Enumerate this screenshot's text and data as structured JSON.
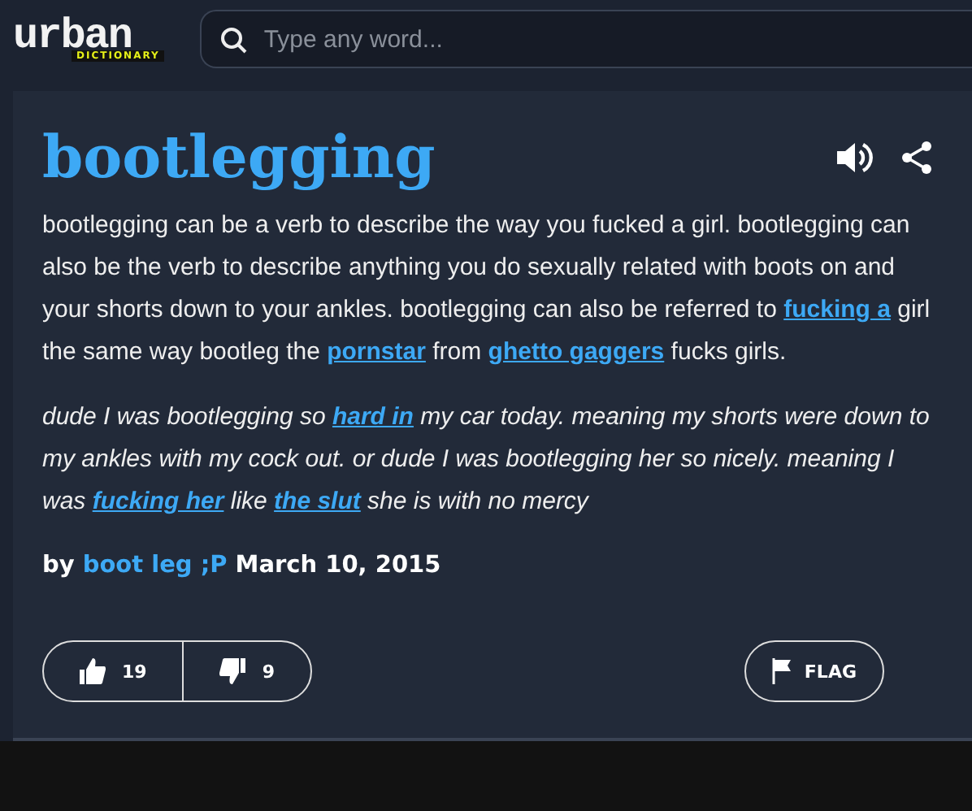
{
  "header": {
    "logo": {
      "word": "urban",
      "sub": "DICTIONARY"
    },
    "search": {
      "placeholder": "Type any word..."
    }
  },
  "entry": {
    "word": "bootlegging",
    "meaning": [
      {
        "text": "bootlegging can be a verb to describe the way you fucked a girl. bootlegging can also be the verb to describe anything you do sexually related with boots on and your shorts down to your ankles. bootlegging can also be referred to ",
        "kind": "text"
      },
      {
        "text": "fucking a",
        "kind": "link"
      },
      {
        "text": " girl the same way bootleg the ",
        "kind": "text"
      },
      {
        "text": "pornstar",
        "kind": "link"
      },
      {
        "text": " from ",
        "kind": "text"
      },
      {
        "text": "ghetto gaggers",
        "kind": "link"
      },
      {
        "text": " fucks girls.",
        "kind": "text"
      }
    ],
    "example": [
      {
        "text": "dude I was bootlegging so ",
        "kind": "text"
      },
      {
        "text": "hard in",
        "kind": "link"
      },
      {
        "text": " my car today. meaning my shorts were down to my ankles with my cock out. or dude I was bootlegging her so nicely. meaning I was ",
        "kind": "text"
      },
      {
        "text": "fucking her",
        "kind": "link"
      },
      {
        "text": " like ",
        "kind": "text"
      },
      {
        "text": "the slut",
        "kind": "link"
      },
      {
        "text": " she is with no mercy",
        "kind": "text"
      }
    ],
    "by": "by",
    "author": "boot leg ;P",
    "date": "March 10, 2015",
    "votes": {
      "up": "19",
      "down": "9"
    },
    "flag": "FLAG"
  }
}
